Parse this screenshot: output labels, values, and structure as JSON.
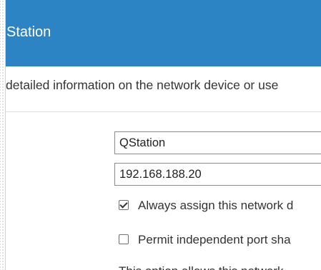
{
  "dialog": {
    "title": "Station",
    "description": "detailed information on the network device or use",
    "fields": {
      "device_name": "QStation",
      "ip_address": "192.168.188.20"
    },
    "options": [
      {
        "label": "Always assign this network d",
        "checked": true
      },
      {
        "label": "Permit independent port sha",
        "checked": false
      }
    ],
    "footer_partial_text": "This option allows this network"
  }
}
